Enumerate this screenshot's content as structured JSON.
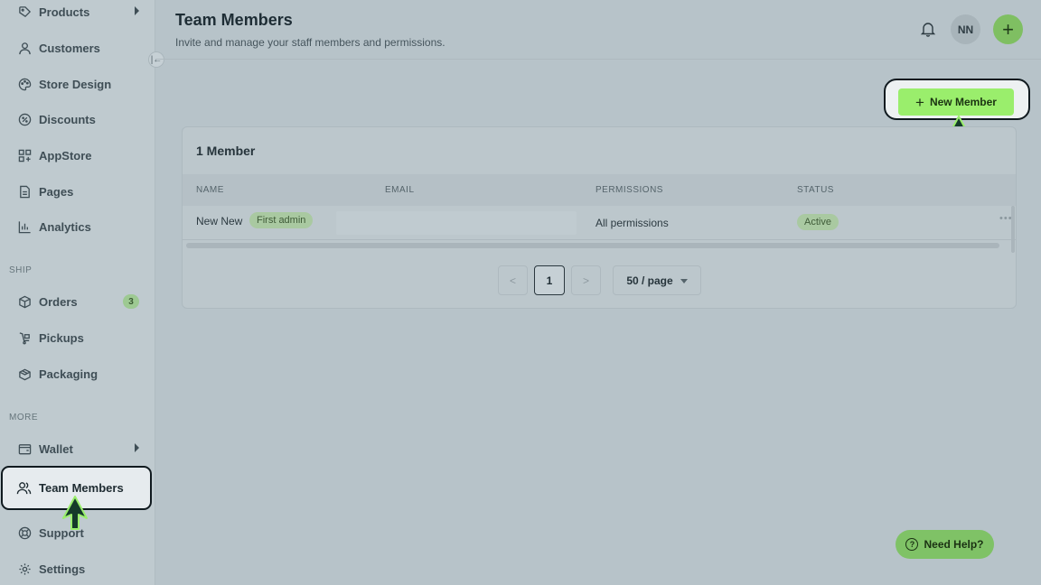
{
  "sidebar": {
    "items": [
      {
        "label": "Products",
        "icon": "tag-icon",
        "has_caret": true
      },
      {
        "label": "Customers",
        "icon": "user-icon"
      },
      {
        "label": "Store Design",
        "icon": "palette-icon"
      },
      {
        "label": "Discounts",
        "icon": "discount-icon"
      },
      {
        "label": "AppStore",
        "icon": "apps-icon"
      },
      {
        "label": "Pages",
        "icon": "page-icon"
      },
      {
        "label": "Analytics",
        "icon": "chart-icon"
      }
    ],
    "ship_label": "SHIP",
    "ship_items": [
      {
        "label": "Orders",
        "icon": "box-icon",
        "count": "3"
      },
      {
        "label": "Pickups",
        "icon": "pickup-icon"
      },
      {
        "label": "Packaging",
        "icon": "package-icon"
      }
    ],
    "more_label": "MORE",
    "more_items": [
      {
        "label": "Wallet",
        "icon": "wallet-icon",
        "has_caret": true
      },
      {
        "label": "Team Members",
        "icon": "team-icon",
        "active": true
      },
      {
        "label": "Support",
        "icon": "support-icon"
      },
      {
        "label": "Settings",
        "icon": "gear-icon"
      }
    ],
    "collapse_glyph": "|←"
  },
  "header": {
    "title": "Team Members",
    "subtitle": "Invite and manage your staff members and permissions.",
    "avatar_initials": "NN",
    "plus_glyph": "+"
  },
  "actions": {
    "new_member_label": "New Member",
    "new_member_glyph": "+"
  },
  "table": {
    "count_label": "1 Member",
    "columns": [
      "NAME",
      "EMAIL",
      "PERMISSIONS",
      "STATUS"
    ],
    "rows": [
      {
        "name": "New New",
        "tag": "First admin",
        "email": "",
        "permissions": "All permissions",
        "status": "Active"
      }
    ],
    "more_glyph": "•••"
  },
  "pagination": {
    "prev": "<",
    "current": "1",
    "next": ">",
    "page_size": "50 / page"
  },
  "help": {
    "label": "Need Help?",
    "glyph": "?"
  },
  "colors": {
    "accent_green": "#9aee6c",
    "tag_green": "#a9c9a1",
    "overlay_bg": "#b7c3c9"
  }
}
